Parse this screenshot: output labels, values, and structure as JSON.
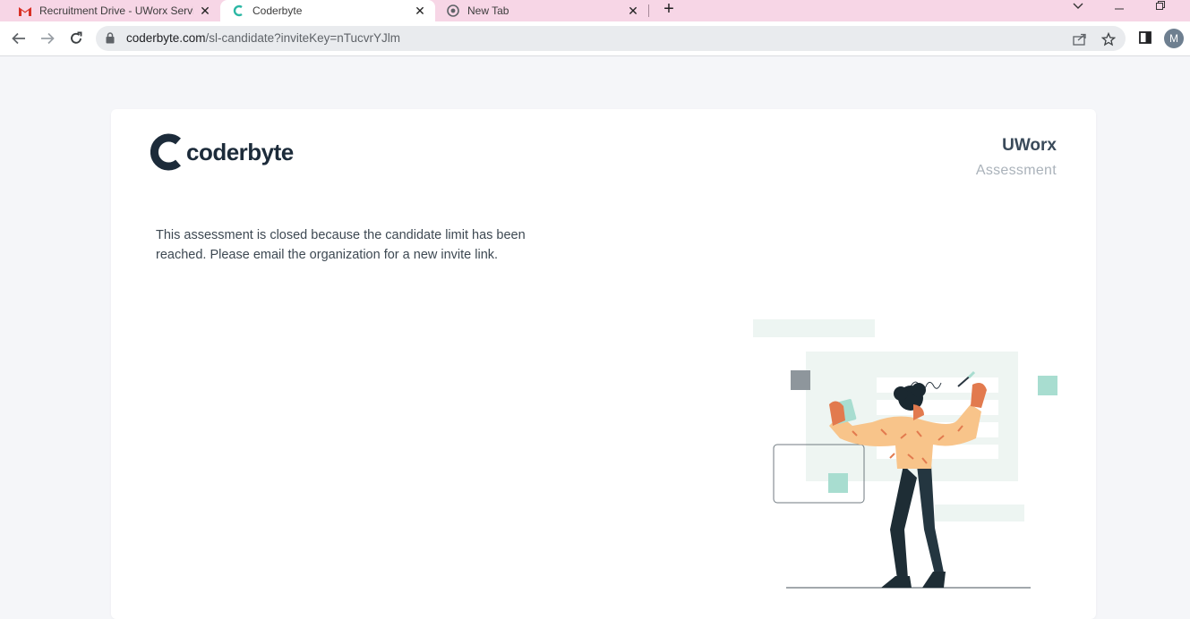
{
  "browser": {
    "tabs": [
      {
        "title": "Recruitment Drive - UWorx Servic",
        "favicon": "gmail-icon",
        "active": false
      },
      {
        "title": "Coderbyte",
        "favicon": "coderbyte-icon",
        "active": true
      },
      {
        "title": "New Tab",
        "favicon": "chrome-icon",
        "active": false
      }
    ],
    "url_host": "coderbyte.com",
    "url_path": "/sl-candidate?inviteKey=nTucvrYJlm",
    "profile_initial": "M"
  },
  "page": {
    "logo_text": "coderbyte",
    "org_name": "UWorx",
    "org_subtitle": "Assessment",
    "message": "This assessment is closed because the candidate limit has been reached. Please email the organization for a new invite link."
  },
  "colors": {
    "tabstrip": "#f7d6e6",
    "brand_dark": "#1c2b3a",
    "accent_teal": "#a8ddd0"
  }
}
